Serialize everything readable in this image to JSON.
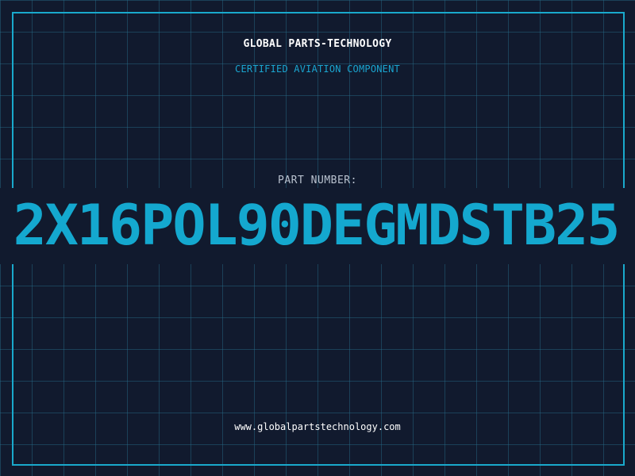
{
  "header": {
    "company": "GLOBAL PARTS-TECHNOLOGY",
    "subtitle": "CERTIFIED AVIATION COMPONENT"
  },
  "part": {
    "label": "PART NUMBER:",
    "number": "2X16POL90DEGMDSTB25"
  },
  "footer": {
    "website": "www.globalpartstechnology.com"
  },
  "colors": {
    "background": "#111a2e",
    "grid": "#286e8c",
    "accent": "#19a9cc",
    "text": "#ffffff",
    "muted": "#b9c2cf"
  }
}
